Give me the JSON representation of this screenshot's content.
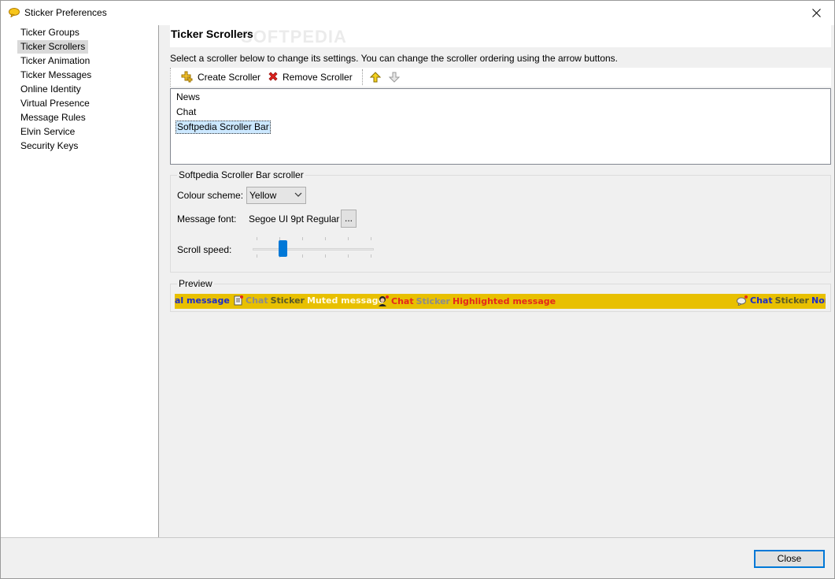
{
  "window": {
    "title": "Sticker Preferences"
  },
  "sidebar": {
    "items": [
      {
        "label": "Ticker Groups"
      },
      {
        "label": "Ticker Scrollers",
        "selected": true
      },
      {
        "label": "Ticker Animation"
      },
      {
        "label": "Ticker Messages"
      },
      {
        "label": "Online Identity"
      },
      {
        "label": "Virtual Presence"
      },
      {
        "label": "Message Rules"
      },
      {
        "label": "Elvin Service"
      },
      {
        "label": "Security Keys"
      }
    ]
  },
  "main": {
    "heading": "Ticker Scrollers",
    "watermark": "SOFTPEDIA",
    "instructions": "Select a scroller below to change its settings. You can change the scroller ordering using the arrow buttons.",
    "toolbar": {
      "create_label": "Create Scroller",
      "remove_label": "Remove Scroller"
    },
    "scrollers": [
      {
        "label": "News"
      },
      {
        "label": "Chat"
      },
      {
        "label": "Softpedia Scroller Bar",
        "selected": true
      }
    ],
    "settings": {
      "group_title": "Softpedia Scroller Bar scroller",
      "colour_label": "Colour scheme:",
      "colour_value": "Yellow",
      "font_label": "Message font:",
      "font_value": "Segoe UI 9pt Regular",
      "font_button": "...",
      "speed_label": "Scroll speed:",
      "speed_fraction": 0.2
    },
    "preview": {
      "group_title": "Preview",
      "bar_color": "#e8c000",
      "seg1_text": "al message",
      "seg2_chat": "Chat",
      "seg2_sticker": "Sticker",
      "seg2_msg": "Muted message",
      "seg3_chat": "Chat",
      "seg3_sticker": "Sticker",
      "seg3_msg": "Highlighted message",
      "seg4_chat": "Chat",
      "seg4_sticker": "Sticker",
      "seg4_msg": "Norm"
    }
  },
  "footer": {
    "close_label": "Close"
  },
  "colors": {
    "accent": "#0078d7",
    "selection": "#cce8ff"
  }
}
